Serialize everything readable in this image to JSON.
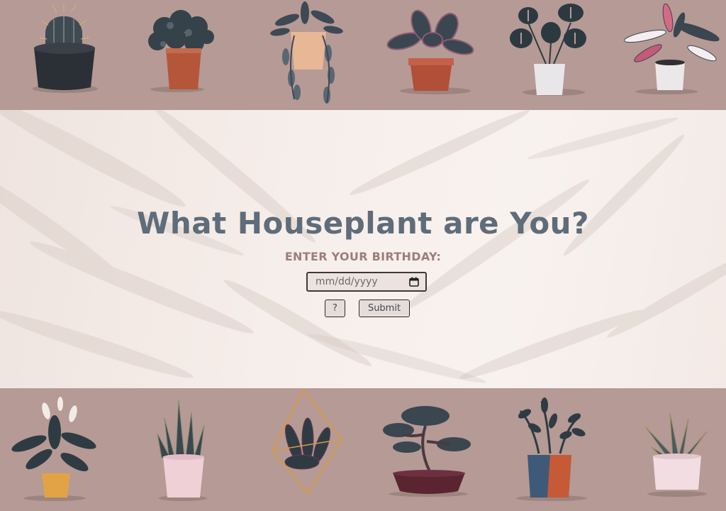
{
  "hero": {
    "title": "What Houseplant are You?",
    "prompt": "ENTER YOUR BIRTHDAY:"
  },
  "birthday_input": {
    "placeholder": "mm/dd/yyyy",
    "icon": "calendar-icon"
  },
  "buttons": {
    "help_label": "?",
    "submit_label": "Submit"
  },
  "colors": {
    "band_background": "#b59a95",
    "hero_background": "#f6eeea",
    "title": "#5f6c79",
    "prompt": "#9a7f78",
    "leaf_dark": "#3a4650",
    "pot_terracotta": "#b5563a",
    "pot_white": "#e9e6ea"
  },
  "top_plants": [
    "cactus-plant",
    "round-leaf-plant",
    "trailing-pothos-plant",
    "calathea-plant",
    "monstera-plant",
    "stromanthe-plant"
  ],
  "bottom_plants": [
    "peace-lily-plant",
    "snake-plant",
    "terrarium-plant",
    "bonsai-plant",
    "zz-plant",
    "aloe-plant"
  ]
}
